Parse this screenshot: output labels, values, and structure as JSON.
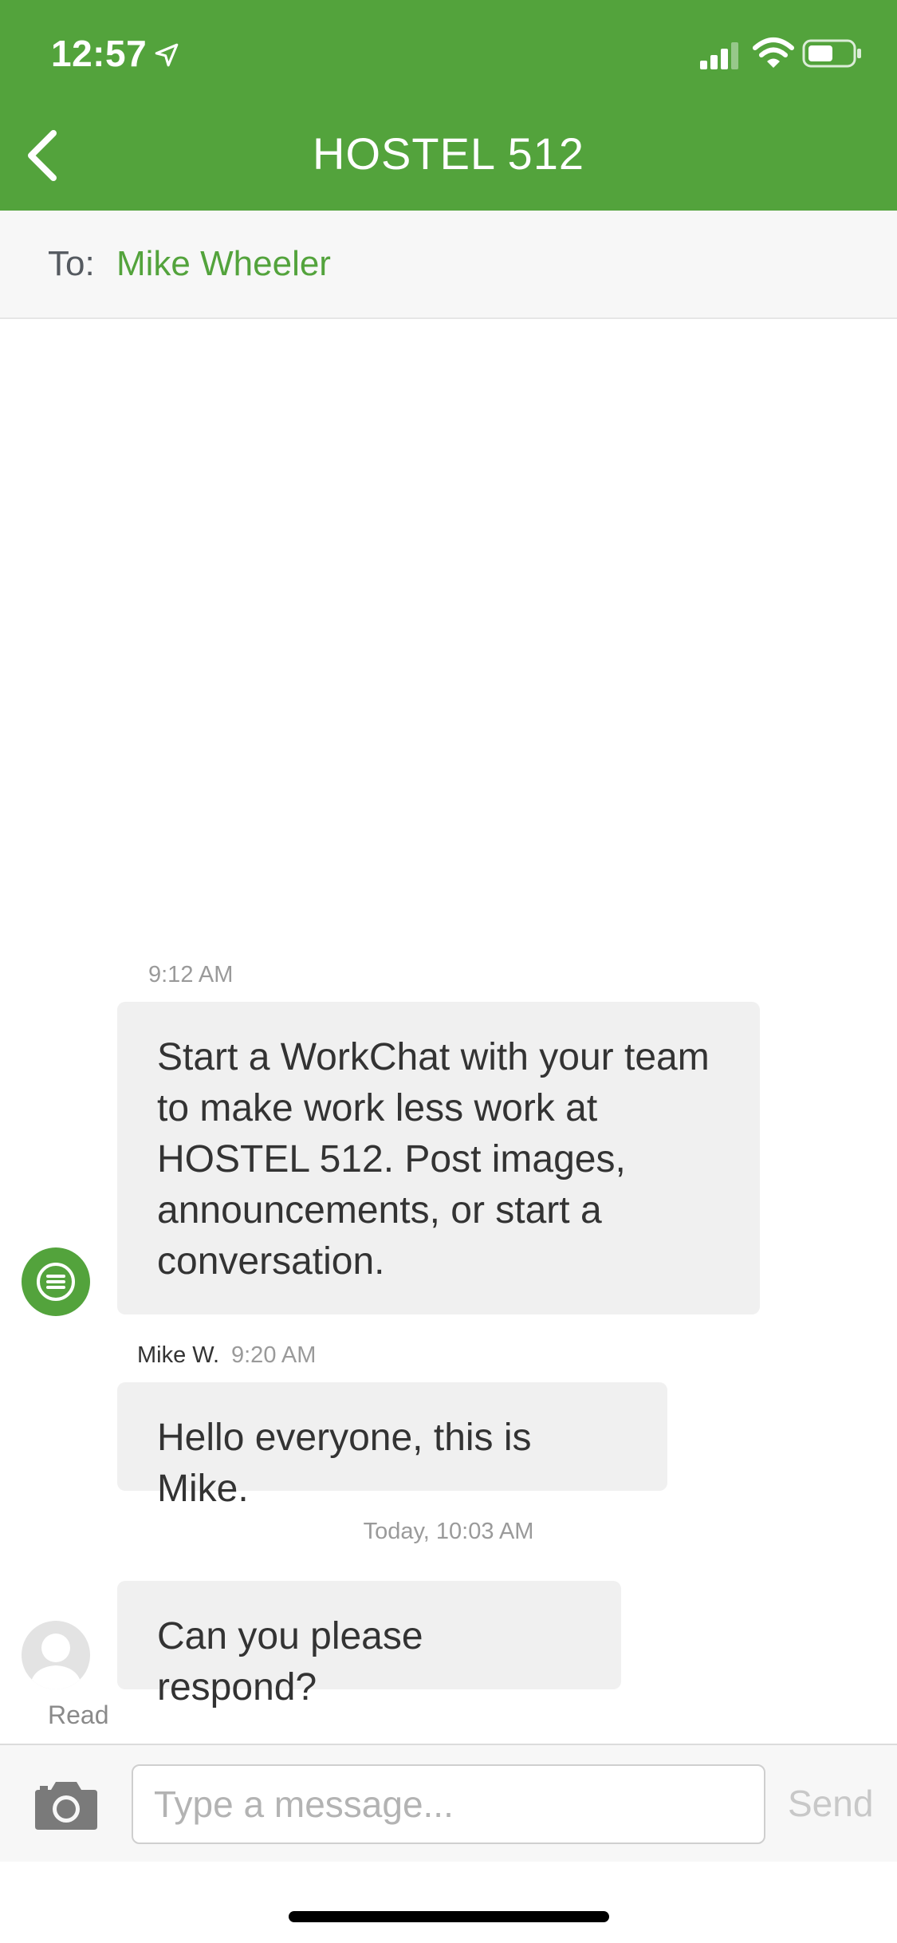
{
  "status_bar": {
    "time": "12:57",
    "icons": [
      "location-arrow-icon",
      "signal-bars-icon",
      "wifi-icon",
      "battery-icon"
    ]
  },
  "header": {
    "title": "HOSTEL 512",
    "back_icon": "chevron-left-icon",
    "background_color": "#53a33c"
  },
  "recipient": {
    "label": "To:",
    "name": "Mike Wheeler"
  },
  "messages": [
    {
      "time": "9:12 AM",
      "text": "Start a WorkChat with your team to make work less work at HOSTEL 512. Post images, announcements, or start a conversation.",
      "avatar": "workchat-bot-icon"
    },
    {
      "sender": "Mike W.",
      "time": "9:20 AM",
      "text": "Hello everyone, this is Mike."
    },
    {
      "divider": "Today, 10:03 AM",
      "text": "Can you please respond?",
      "avatar": "user-avatar-icon",
      "status": "Read"
    }
  ],
  "compose": {
    "placeholder": "Type a message...",
    "send_label": "Send",
    "camera_icon": "camera-icon"
  },
  "colors": {
    "accent": "#53a33c",
    "bubble": "#f0f0f0"
  }
}
